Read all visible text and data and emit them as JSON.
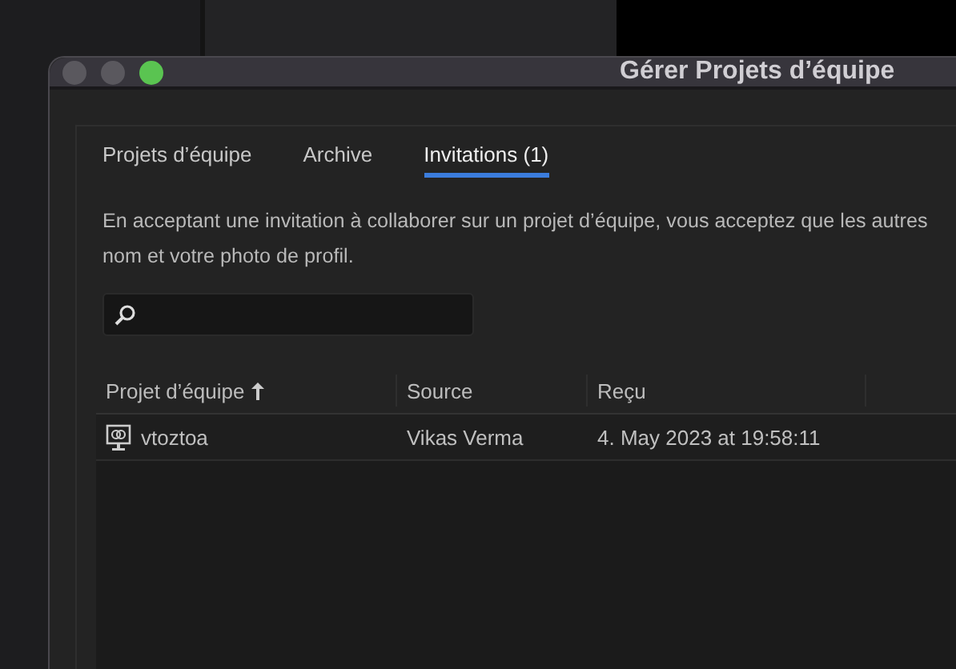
{
  "window": {
    "title": "Gérer Projets d’équipe"
  },
  "tabs": [
    {
      "label": "Projets d’équipe",
      "selected": false
    },
    {
      "label": "Archive",
      "selected": false
    },
    {
      "label": "Invitations (1)",
      "selected": true
    }
  ],
  "description_lines": [
    "En acceptant une invitation à collaborer sur un projet d’équipe, vous acceptez que les autres",
    "nom et votre photo de profil."
  ],
  "table": {
    "columns": [
      {
        "label": "Projet d’équipe",
        "sorted": true
      },
      {
        "label": "Source",
        "sorted": false
      },
      {
        "label": "Reçu",
        "sorted": false
      }
    ],
    "rows": [
      {
        "cells": [
          "vtoztoa",
          "Vikas Verma",
          "4. May 2023 at 19:58:11"
        ]
      }
    ]
  }
}
